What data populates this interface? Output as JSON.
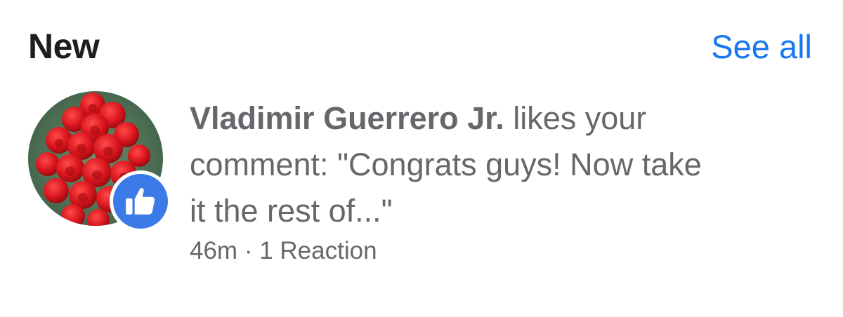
{
  "header": {
    "title": "New",
    "see_all": "See all"
  },
  "notification": {
    "actor": "Vladimir Guerrero Jr.",
    "action": " likes your comment: \"Congrats guys! Now take it the rest of...\"",
    "time": "46m",
    "separator": " · ",
    "reactions": "1 Reaction",
    "reaction_type": "like",
    "badge_icon": "thumbs-up-icon",
    "colors": {
      "accent": "#1877f2",
      "badge": "#3b7be8",
      "secondary_text": "#65676b"
    }
  }
}
